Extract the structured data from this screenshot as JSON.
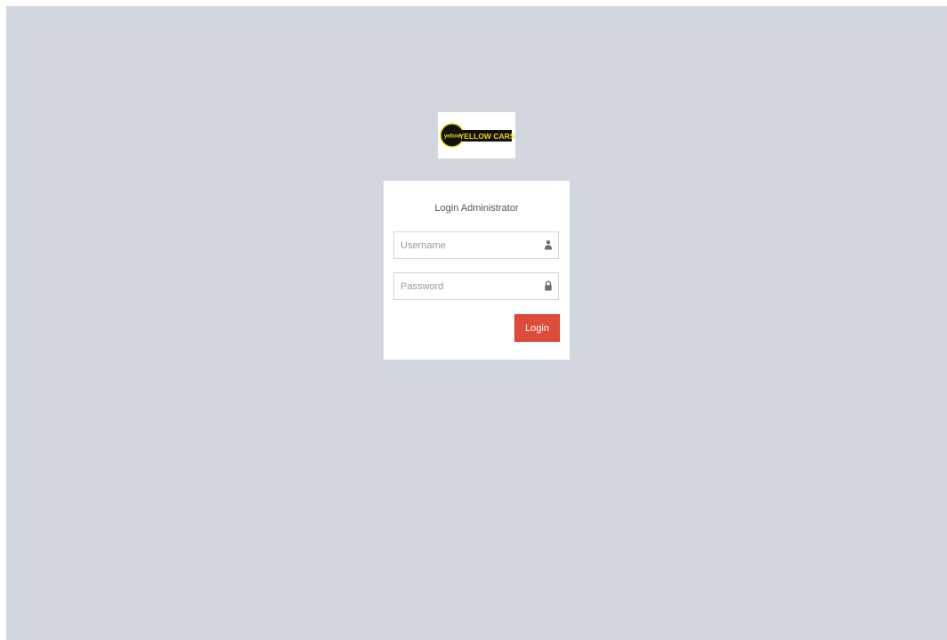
{
  "logo": {
    "badge_text": "yellow",
    "wordmark_text": "YELLOW CARS",
    "colors": {
      "badge": "#111111",
      "accent": "#f2d400"
    }
  },
  "login": {
    "title": "Login Administrator",
    "username": {
      "placeholder": "Username",
      "value": "",
      "icon": "user-icon"
    },
    "password": {
      "placeholder": "Password",
      "value": "",
      "icon": "lock-icon"
    },
    "submit_label": "Login"
  },
  "colors": {
    "background": "#d2d6de",
    "panel": "#ffffff",
    "button": "#dd4b39"
  }
}
